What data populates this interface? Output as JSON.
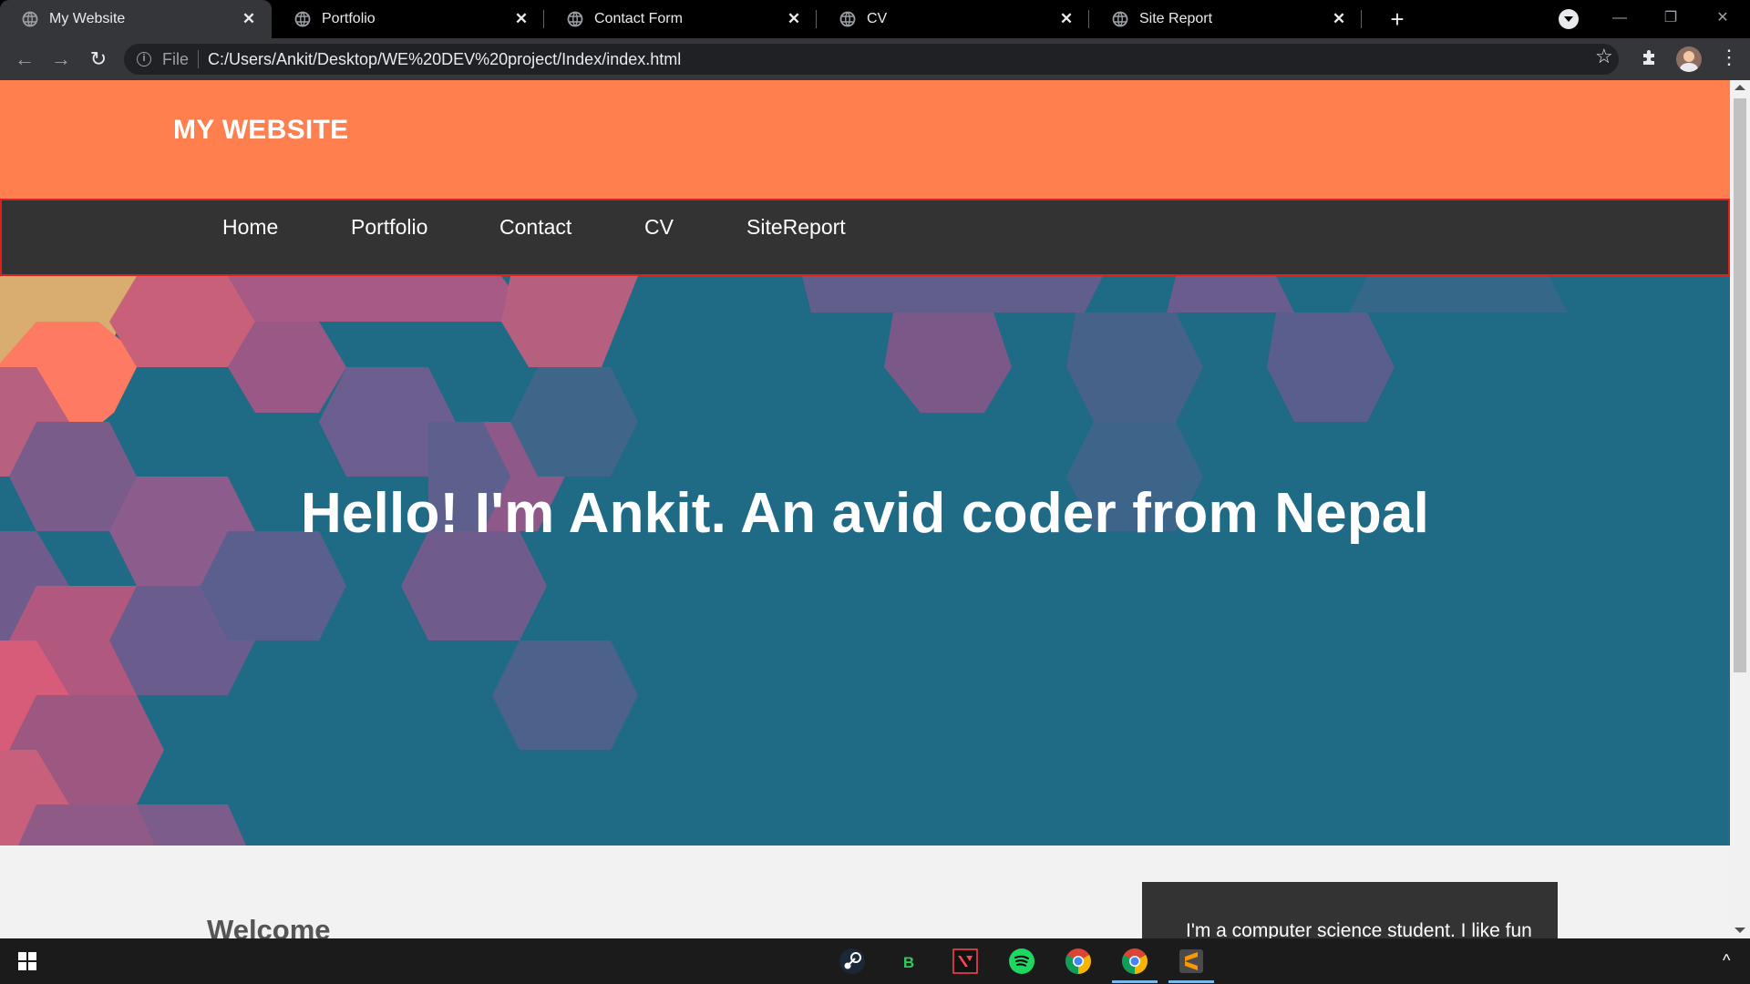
{
  "browser": {
    "tabs": [
      {
        "title": "My Website",
        "active": true
      },
      {
        "title": "Portfolio",
        "active": false
      },
      {
        "title": "Contact Form",
        "active": false
      },
      {
        "title": "CV",
        "active": false
      },
      {
        "title": "Site Report",
        "active": false
      }
    ],
    "new_tab_label": "+",
    "address": {
      "scheme": "File",
      "url": "C:/Users/Ankit/Desktop/WE%20DEV%20project/Index/index.html"
    }
  },
  "page": {
    "logo": "MY WEBSITE",
    "nav": [
      "Home",
      "Portfolio",
      "Contact",
      "CV",
      "SiteReport"
    ],
    "hero_title": "Hello! I'm Ankit. An avid coder from Nepal",
    "welcome_heading": "Welcome",
    "about_text": "I'm a computer science student. I like fun"
  },
  "taskbar": {
    "apps": [
      "steam-icon",
      "b-app-icon",
      "valorant-icon",
      "spotify-icon",
      "chrome-icon",
      "chrome-icon",
      "sublime-text-icon"
    ]
  },
  "colors": {
    "header": "#ff7f4f",
    "nav": "#333333",
    "nav_border": "#e0201b",
    "hero": "#1f6a85"
  }
}
